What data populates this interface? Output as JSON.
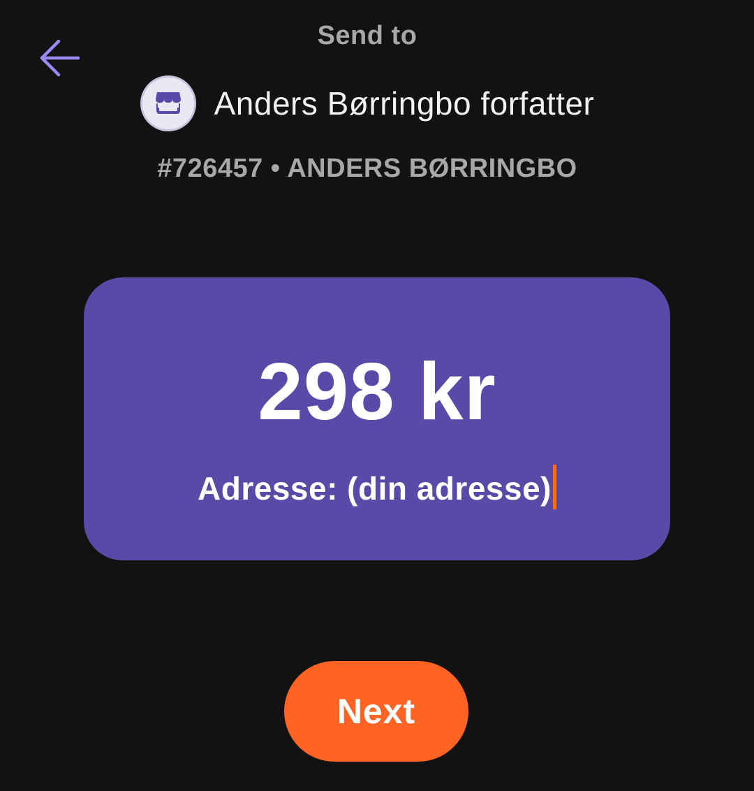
{
  "header": {
    "title": "Send to",
    "back_icon": "arrow-left-icon"
  },
  "recipient": {
    "avatar_icon": "storefront-icon",
    "name": "Anders Børringbo forfatter",
    "id_line": "#726457 • ANDERS BØRRINGBO"
  },
  "payment": {
    "amount": "298 kr",
    "message": "Adresse: (din adresse)"
  },
  "actions": {
    "next_label": "Next"
  },
  "colors": {
    "background": "#121212",
    "card": "#5a4aa8",
    "accent": "#ff6424",
    "back_arrow": "#9b8af0",
    "muted_text": "#a8a8a8"
  }
}
